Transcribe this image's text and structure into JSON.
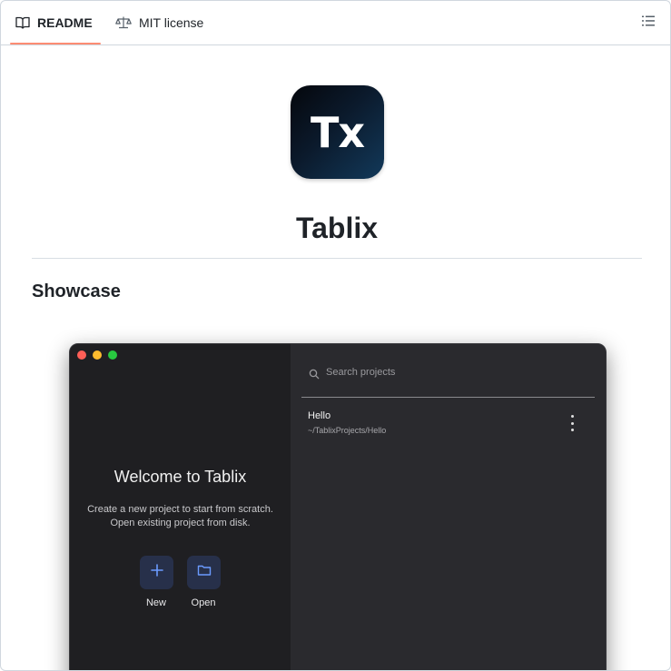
{
  "tabs": [
    {
      "label": "README",
      "icon": "book-icon"
    },
    {
      "label": "MIT license",
      "icon": "scale-icon"
    }
  ],
  "toc_icon": "list-unordered-icon",
  "logo": {
    "text": "Tx"
  },
  "readme": {
    "title": "Tablix",
    "section_heading": "Showcase"
  },
  "app": {
    "window_controls": [
      "close",
      "minimize",
      "zoom"
    ],
    "welcome_title": "Welcome to Tablix",
    "welcome_line1": "Create a new project to start from scratch.",
    "welcome_line2": "Open existing project from disk.",
    "actions": [
      {
        "label": "New",
        "icon": "plus-icon"
      },
      {
        "label": "Open",
        "icon": "folder-icon"
      }
    ],
    "search": {
      "placeholder": "Search projects",
      "value": ""
    },
    "projects": [
      {
        "name": "Hello",
        "path": "~/TablixProjects/Hello"
      }
    ]
  },
  "colors": {
    "tab_underline": "#fd8c73",
    "accent_blue": "#6b9bff"
  }
}
